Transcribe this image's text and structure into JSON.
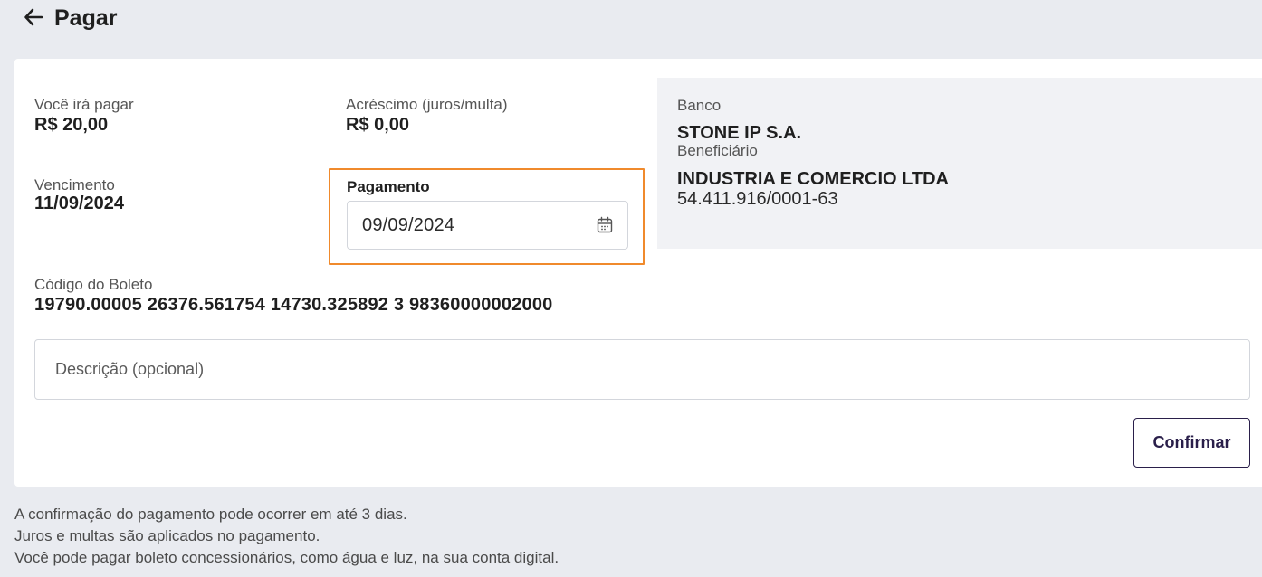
{
  "header": {
    "title": "Pagar",
    "back_icon": "arrow-left-icon"
  },
  "summary": {
    "pagar_label": "Você irá pagar",
    "pagar_value": "R$ 20,00",
    "acrescimo_label": "Acréscimo (juros/multa)",
    "acrescimo_value": "R$ 0,00",
    "vencimento_label": "Vencimento",
    "vencimento_value": "11/09/2024"
  },
  "pagamento": {
    "label": "Pagamento",
    "value": "09/09/2024",
    "icon": "calendar-icon",
    "highlight_color": "#f08a2c"
  },
  "banco": {
    "bank_label": "Banco",
    "bank_name": "STONE IP S.A.",
    "beneficiario_label": "Beneficiário",
    "beneficiario_name": "INDUSTRIA E COMERCIO LTDA",
    "beneficiario_doc": "54.411.916/0001-63"
  },
  "boleto": {
    "label": "Código do Boleto",
    "code": "19790.00005 26376.561754 14730.325892 3 98360000002000"
  },
  "descricao": {
    "placeholder": "Descrição (opcional)"
  },
  "actions": {
    "confirm_label": "Confirmar",
    "confirm_color": "#2a1f4a"
  },
  "notes": [
    "A confirmação do pagamento pode ocorrer em até 3 dias.",
    "Juros e multas são aplicados no pagamento.",
    "Você pode pagar boleto concessionários, como água e luz, na sua conta digital."
  ]
}
